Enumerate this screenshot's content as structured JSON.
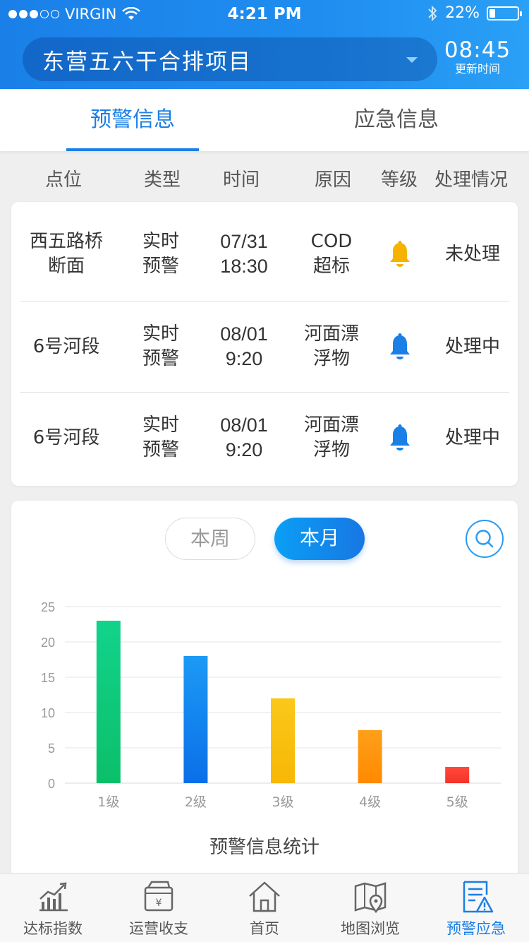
{
  "status_bar": {
    "carrier": "VIRGIN",
    "time": "4:21 PM",
    "battery": "22%",
    "battery_level": 0.22,
    "signal_bars": 3
  },
  "header": {
    "project": "东营五六干合排项目",
    "update_time": "08:45",
    "update_label": "更新时间"
  },
  "tabs": [
    {
      "label": "预警信息",
      "active": true
    },
    {
      "label": "应急信息",
      "active": false
    }
  ],
  "columns": [
    "点位",
    "类型",
    "时间",
    "原因",
    "等级",
    "处理情况"
  ],
  "rows": [
    {
      "site": "西五路桥断面",
      "type": "实时预警",
      "date": "07/31",
      "time": "18:30",
      "reason": "COD超标",
      "level_icon": "bell-icon",
      "level_color": "#f5b300",
      "status": "未处理"
    },
    {
      "site": "6号河段",
      "type": "实时预警",
      "date": "08/01",
      "time": "9:20",
      "reason": "河面漂浮物",
      "level_icon": "bell-icon",
      "level_color": "#1a7fe6",
      "status": "处理中"
    },
    {
      "site": "6号河段",
      "type": "实时预警",
      "date": "08/01",
      "time": "9:20",
      "reason": "河面漂浮物",
      "level_icon": "bell-icon",
      "level_color": "#1a7fe6",
      "status": "处理中"
    }
  ],
  "period_toggle": {
    "week": "本周",
    "month": "本月",
    "selected": "month"
  },
  "chart_data": {
    "type": "bar",
    "title": "预警信息统计",
    "categories": [
      "1级",
      "2级",
      "3级",
      "4级",
      "5级"
    ],
    "values": [
      23,
      18,
      12,
      7.5,
      2.3
    ],
    "ylim": [
      0,
      25
    ],
    "yticks": [
      0,
      5,
      10,
      15,
      20,
      25
    ],
    "grid": true,
    "colors": [
      [
        "#12d38b",
        "#0bbf6a"
      ],
      [
        "#1c9af5",
        "#0b6fe8"
      ],
      [
        "#fbc81a",
        "#f7b705"
      ],
      [
        "#ff9f1a",
        "#ff8a00"
      ],
      [
        "#ff4a3a",
        "#f5332a"
      ]
    ]
  },
  "bottom_nav": [
    {
      "label": "达标指数",
      "icon": "chart-trend-icon",
      "active": false
    },
    {
      "label": "运营收支",
      "icon": "wallet-yen-icon",
      "active": false
    },
    {
      "label": "首页",
      "icon": "home-icon",
      "active": false
    },
    {
      "label": "地图浏览",
      "icon": "map-pin-icon",
      "active": false
    },
    {
      "label": "预警应急",
      "icon": "warning-doc-icon",
      "active": true
    }
  ]
}
